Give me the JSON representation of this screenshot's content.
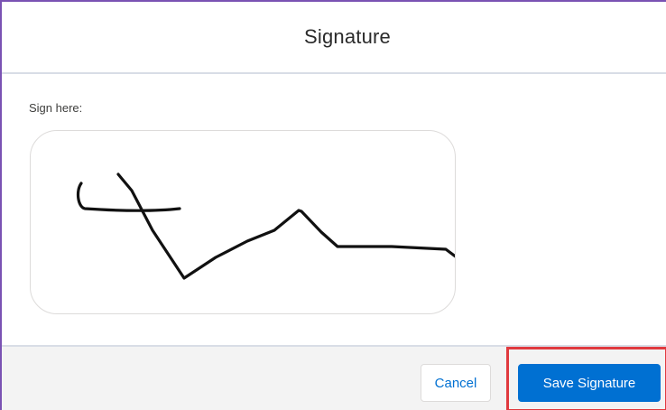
{
  "modal": {
    "title": "Signature",
    "sign_label": "Sign here:"
  },
  "footer": {
    "cancel_label": "Cancel",
    "save_label": "Save Signature"
  },
  "colors": {
    "primary": "#0070d2",
    "highlight": "#e0393e",
    "frame_accent": "#7a52b3",
    "ink": "#111111"
  }
}
